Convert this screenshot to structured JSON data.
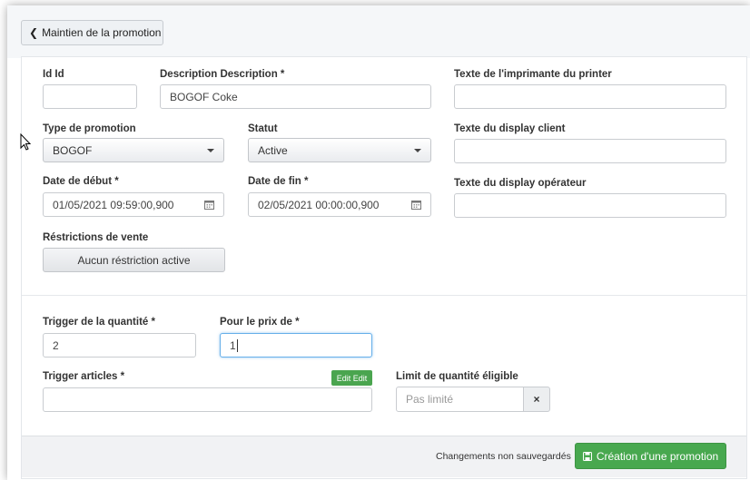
{
  "header": {
    "back_label": "Maintien de la promotion"
  },
  "form": {
    "id": {
      "label": "Id Id",
      "value": ""
    },
    "description": {
      "label": "Description Description *",
      "value": "BOGOF Coke"
    },
    "printer_text": {
      "label": "Texte de l'imprimante du printer",
      "value": ""
    },
    "promo_type": {
      "label": "Type de promotion",
      "value": "BOGOF"
    },
    "status": {
      "label": "Statut",
      "value": "Active"
    },
    "client_display": {
      "label": "Texte du display client",
      "value": ""
    },
    "start_date": {
      "label": "Date de début *",
      "value": "01/05/2021 09:59:00,900"
    },
    "end_date": {
      "label": "Date de fin *",
      "value": "02/05/2021 00:00:00,900"
    },
    "operator_display": {
      "label": "Texte du display opérateur",
      "value": ""
    },
    "restrictions": {
      "label": "Réstrictions de vente",
      "button": "Aucun réstriction active"
    },
    "trigger_qty": {
      "label": "Trigger de la quantité *",
      "value": "2"
    },
    "price": {
      "label": "Pour le prix de *",
      "value": "1"
    },
    "trigger_articles": {
      "label": "Trigger articles *",
      "value": "",
      "edit_label": "Edit Edit"
    },
    "qty_limit": {
      "label": "Limit de quantité éligible",
      "placeholder": "Pas limité",
      "clear_label": "×"
    }
  },
  "footer": {
    "unsaved_text": "Changements non sauvegardés",
    "save_label": "Création d'une promotion"
  },
  "colors": {
    "primary_green": "#48a84f",
    "focus_blue": "#66afe9"
  }
}
